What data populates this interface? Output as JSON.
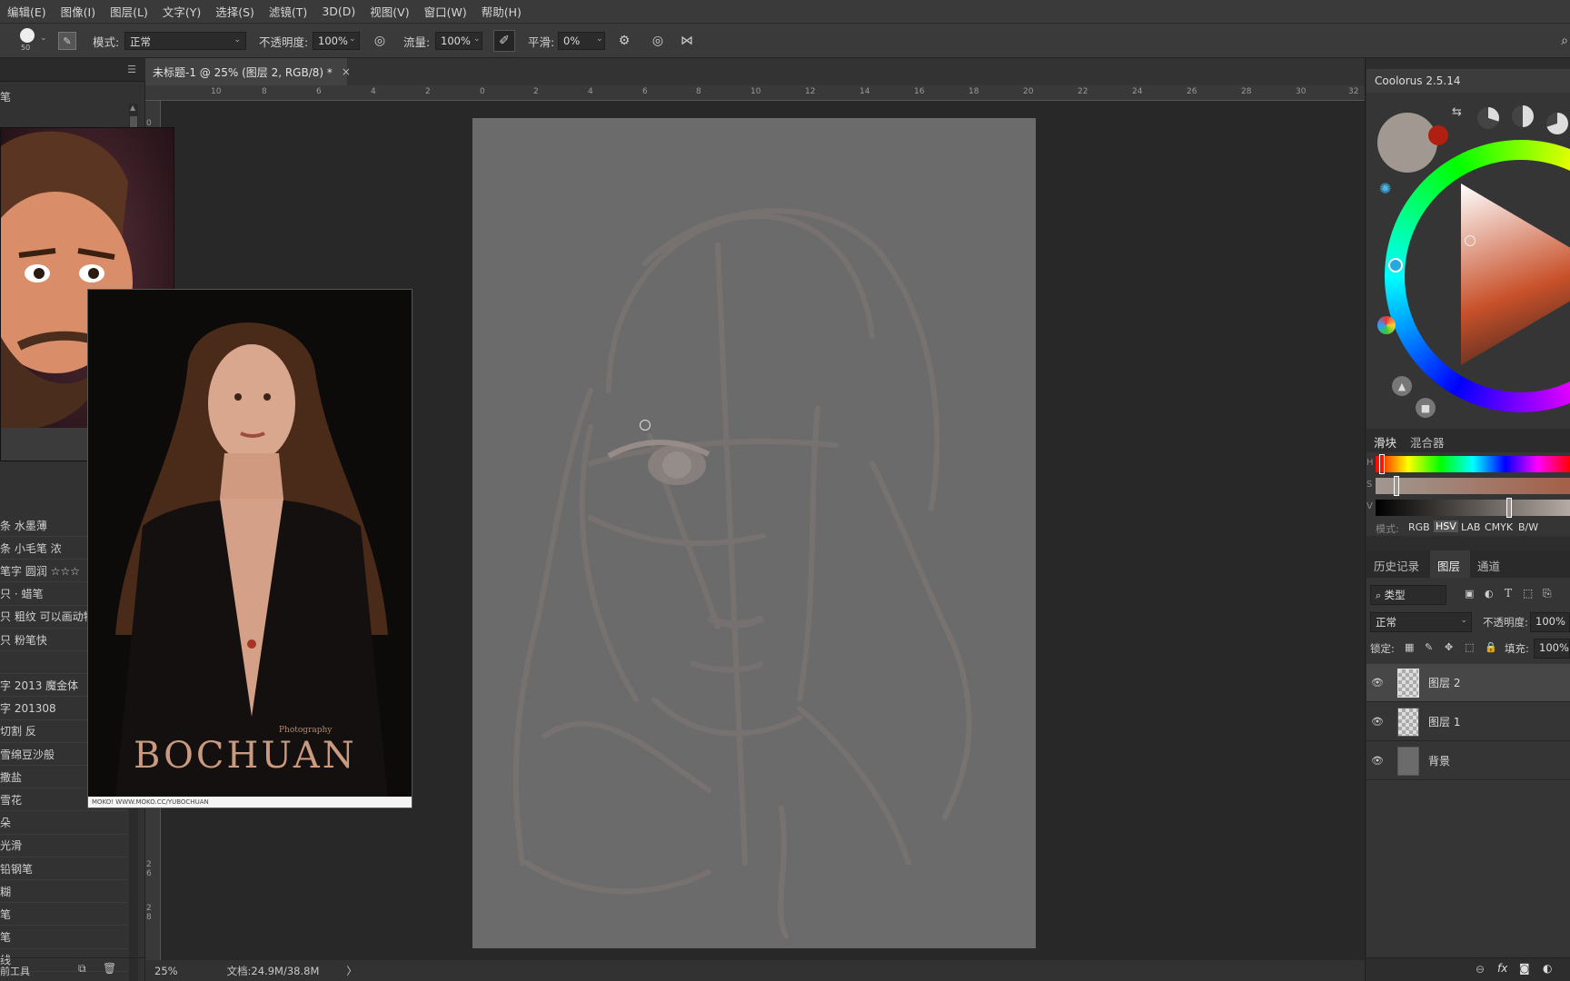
{
  "menu": [
    "编辑(E)",
    "图像(I)",
    "图层(L)",
    "文字(Y)",
    "选择(S)",
    "滤镜(T)",
    "3D(D)",
    "视图(V)",
    "窗口(W)",
    "帮助(H)"
  ],
  "options": {
    "brush_size": "50",
    "mode_label": "模式:",
    "mode_value": "正常",
    "opacity_label": "不透明度:",
    "opacity_value": "100%",
    "flow_label": "流量:",
    "flow_value": "100%",
    "smooth_label": "平滑:",
    "smooth_value": "0%"
  },
  "document_tab": {
    "title": "未标题-1 @ 25% (图层 2, RGB/8) *",
    "close": "×"
  },
  "ruler_h": [
    "10",
    "8",
    "6",
    "4",
    "2",
    "0",
    "2",
    "4",
    "6",
    "8",
    "10",
    "12",
    "14",
    "16",
    "18",
    "20",
    "22",
    "24",
    "26",
    "28",
    "30",
    "32"
  ],
  "ruler_v": [
    "0",
    "2",
    "6",
    "2",
    "8"
  ],
  "left_panel": {
    "header": "笔",
    "brushes": [
      "条 水墨薄",
      "条 小毛笔 浓",
      "笔字 圆润 ☆☆☆",
      "只 · 蜡笔",
      "只 粗纹 可以画动物",
      "只 粉笔快",
      "",
      "字 2013 魔金体",
      "字 201308",
      "切割 反",
      "雪绵豆沙般",
      "撒盐",
      "雪花",
      "朵",
      "光滑",
      "铅钢笔",
      "糊",
      "笔",
      "笔",
      "线"
    ],
    "footer": "前工具"
  },
  "reference": {
    "poster_title": "BOCHUAN",
    "poster_sub": "Photography",
    "poster_url": "MOKO! WWW.MOKO.CC/YUBOCHUAN"
  },
  "status": {
    "zoom": "25%",
    "doc": "文档:24.9M/38.8M",
    "arrow": "〉"
  },
  "coolorus": {
    "title": "Coolorus 2.5.14",
    "tab_slider": "滑块",
    "tab_mixer": "混合器",
    "h": "H",
    "s": "S",
    "v": "V",
    "mode_label": "模式:",
    "modes": [
      "RGB",
      "HSV",
      "LAB",
      "CMYK",
      "B/W"
    ],
    "colors": {
      "current": "#a09891",
      "previous": "#b02010",
      "wheel_accent": "#ffffff"
    }
  },
  "layers_panel": {
    "tabs": [
      "历史记录",
      "图层",
      "通道"
    ],
    "filter": "类型",
    "blend": "正常",
    "opacity_label": "不透明度:",
    "opacity_value": "100%",
    "lock_label": "锁定:",
    "fill_label": "填充:",
    "fill_value": "100%",
    "layers": [
      {
        "name": "图层 2"
      },
      {
        "name": "图层 1"
      },
      {
        "name": "背景"
      }
    ],
    "footer_icons": [
      "link-icon",
      "fx-icon",
      "mask-icon",
      "adjustment-icon"
    ],
    "footer_fx": "fx"
  }
}
